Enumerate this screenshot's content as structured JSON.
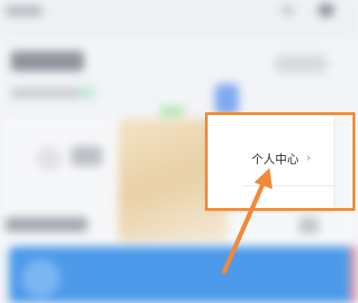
{
  "menu": {
    "personal_center_label": "个人中心",
    "chevron": "›"
  },
  "annotation": {
    "color": "#f08a3a",
    "arrow_target": "personal-center-menu-item"
  },
  "colors": {
    "background": "#f2f4f7",
    "popup": "#ffffff",
    "banner_blue": "#4d9aea"
  }
}
